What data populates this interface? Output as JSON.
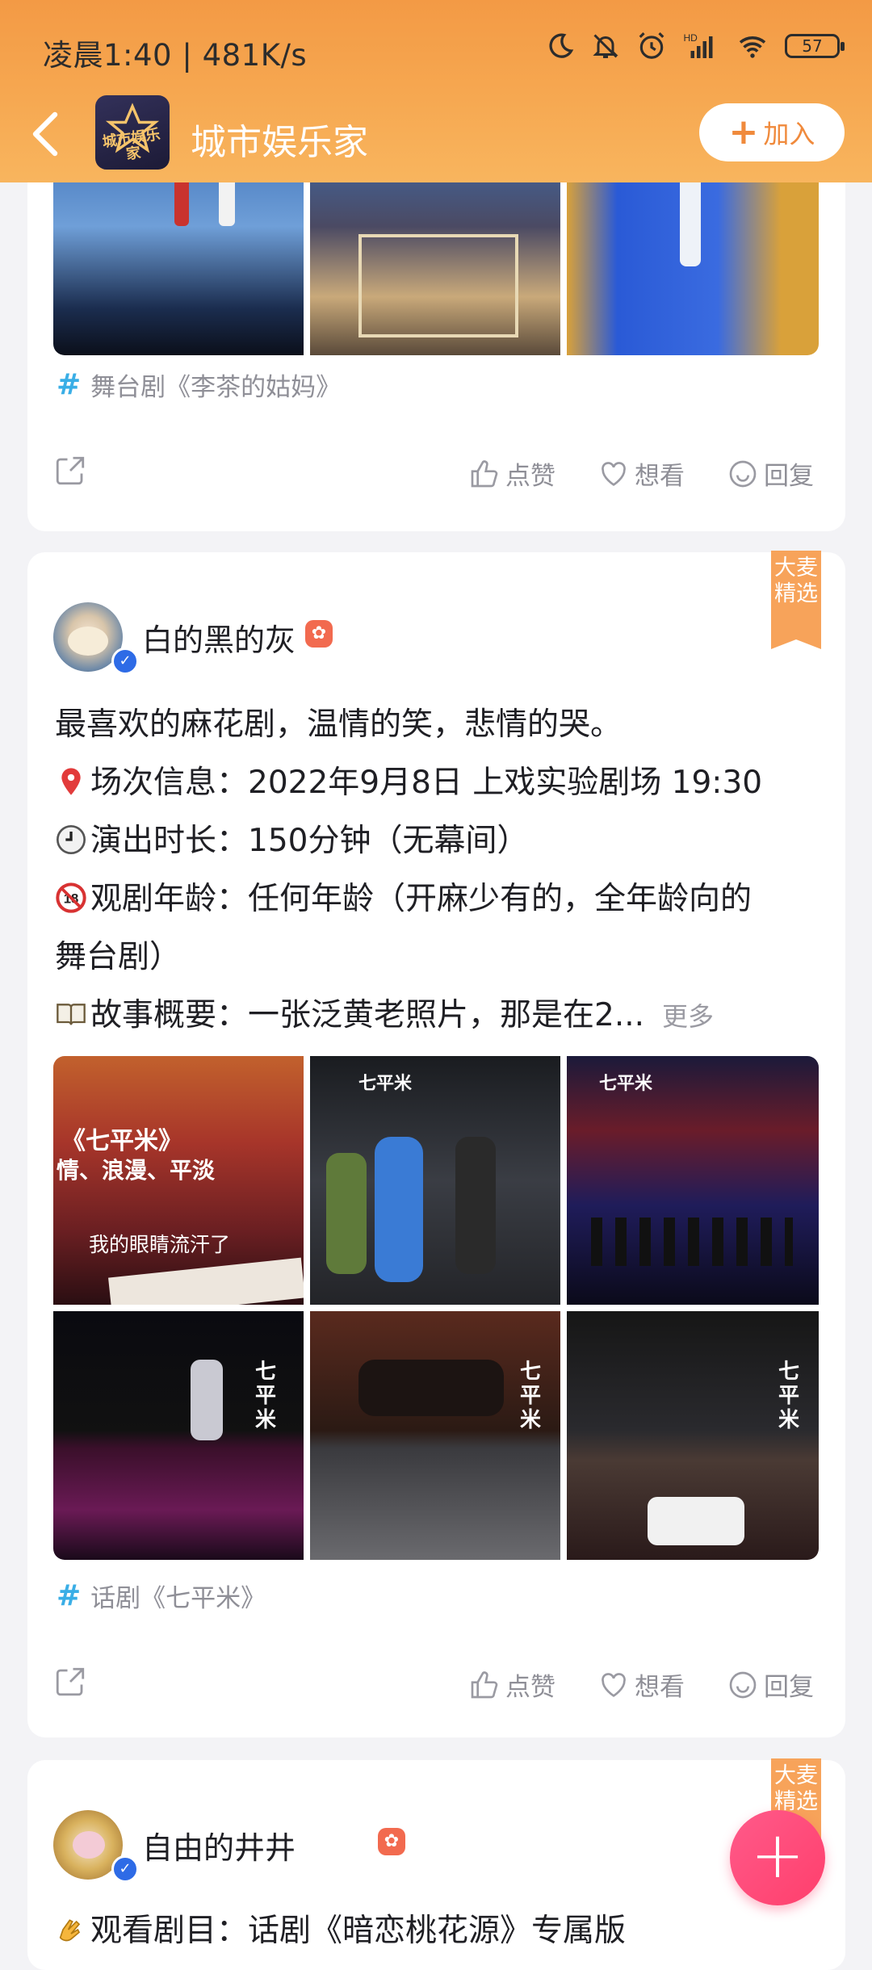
{
  "status_bar": {
    "time_speed": "凌晨1:40 | 481K/s",
    "battery": "57"
  },
  "nav": {
    "title": "城市娱乐家",
    "logo_text": "城市娱乐家",
    "join_label": "加入"
  },
  "post1": {
    "tag": "舞台剧《李茶的姑妈》",
    "actions": {
      "like": "点赞",
      "want": "想看",
      "reply": "回复"
    }
  },
  "post2": {
    "badge": "大麦精选",
    "user": "白的黑的灰",
    "lines": {
      "l1": "最喜欢的麻花剧，温情的笑，悲情的哭。",
      "l2": "场次信息：2022年9月8日 上戏实验剧场 19:30",
      "l3": "演出时长：150分钟（无幕间）",
      "l4": "观剧年龄：任何年龄（开麻少有的，全年龄向的",
      "l5": "舞台剧）",
      "l6": "故事概要：一张泛黄老照片，那是在2..."
    },
    "more": "更多",
    "image1": {
      "line1": "《七平米》",
      "line2": "情、浪漫、平淡",
      "caption": "我的眼睛流汗了"
    },
    "image_watermark": "七平米",
    "tag": "话剧《七平米》",
    "actions": {
      "like": "点赞",
      "want": "想看",
      "reply": "回复"
    }
  },
  "post3": {
    "badge": "大麦精选",
    "user": "自由的井井",
    "line1": "观看剧目：话剧《暗恋桃花源》专属版"
  },
  "fab": "+"
}
